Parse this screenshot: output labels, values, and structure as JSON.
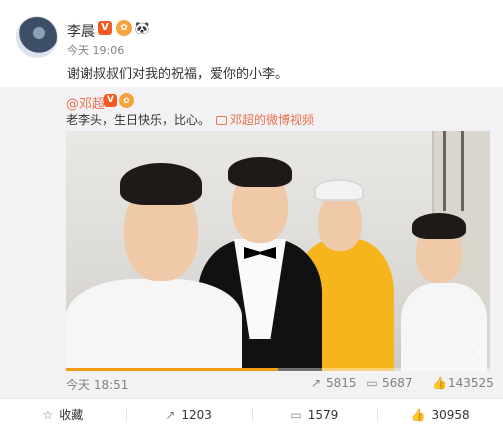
{
  "post": {
    "author": "李晨",
    "badges": {
      "verified": "V",
      "crown": "✿",
      "panda": "🐼"
    },
    "time": "今天 19:06",
    "text": "谢谢叔叔们对我的祝福，爱你的小李。"
  },
  "repost": {
    "author": "@邓超",
    "badges": {
      "verified": "V",
      "crown": "✿"
    },
    "text": "老李头，生日快乐，比心。",
    "video_link": "邓超的微博视频",
    "video": {
      "progress": 0.5
    },
    "time": "今天 18:51",
    "stats": {
      "shares": "5815",
      "comments": "5687",
      "likes": "143525"
    }
  },
  "actions": {
    "favorite": "收藏",
    "share": "1203",
    "comment": "1579",
    "like": "30958"
  },
  "icons": {
    "star": "☆",
    "share": "↗",
    "comment": "▭",
    "like": "👍",
    "expand": "⤢"
  },
  "colors": {
    "link": "#eb7350",
    "muted": "#808080",
    "repost_bg": "#f2f2f5",
    "accent": "#f29a13"
  }
}
